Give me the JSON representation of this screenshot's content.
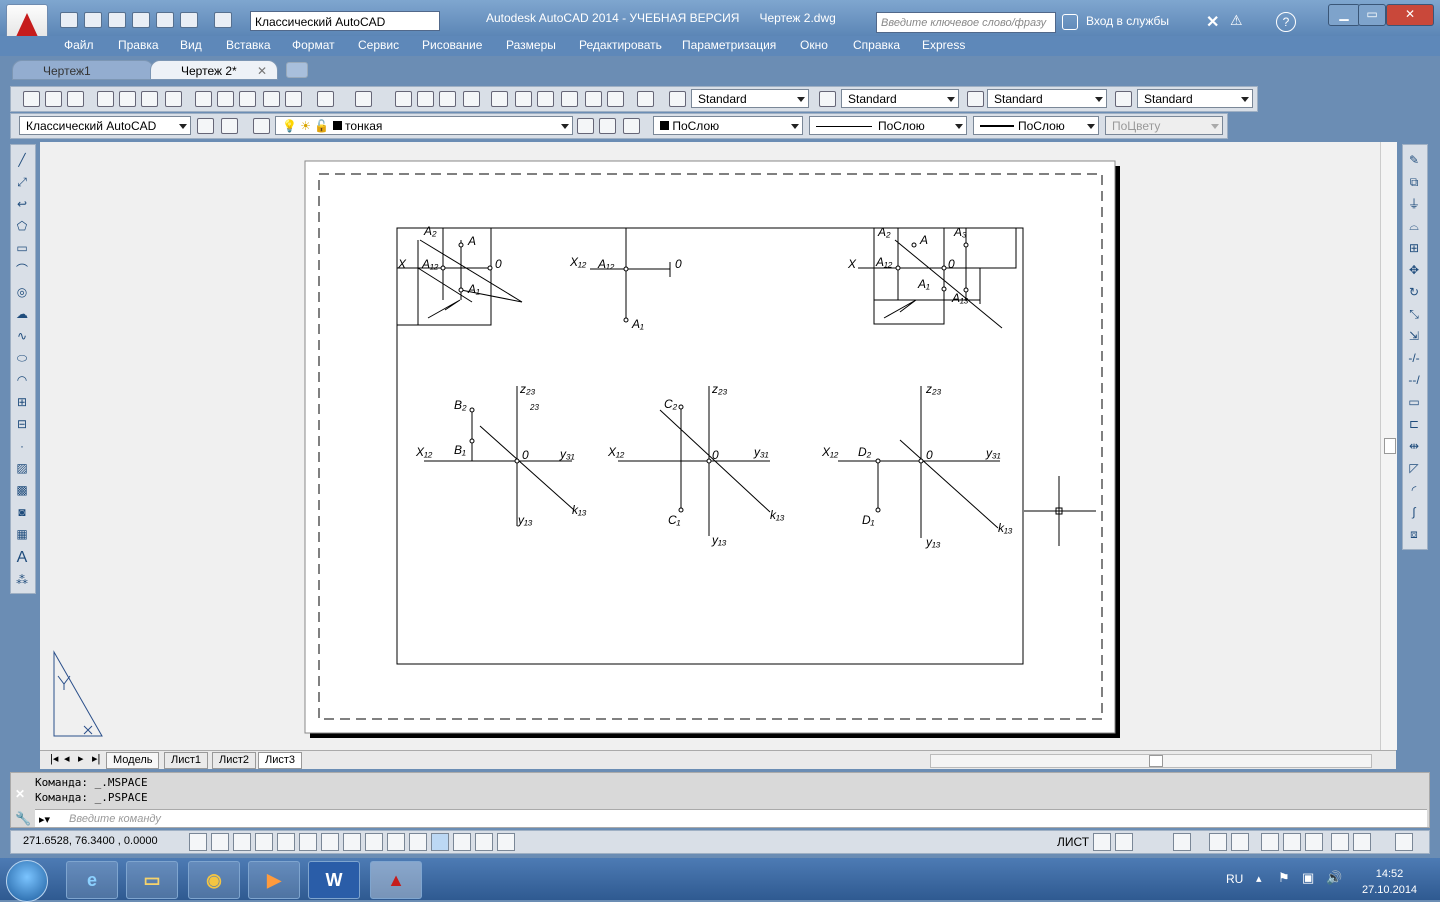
{
  "window": {
    "title": "Autodesk AutoCAD 2014 - УЧЕБНАЯ ВЕРСИЯ",
    "filename": "Чертеж 2.dwg",
    "workspace": "Классический AutoCAD",
    "search_placeholder": "Введите ключевое слово/фразу",
    "login": "Вход в службы",
    "help_label": "?"
  },
  "menu": [
    "Файл",
    "Правка",
    "Вид",
    "Вставка",
    "Формат",
    "Сервис",
    "Рисование",
    "Размеры",
    "Редактировать",
    "Параметризация",
    "Окно",
    "Справка",
    "Express"
  ],
  "doc_tabs": [
    {
      "label": "Чертеж1",
      "active": false
    },
    {
      "label": "Чертеж 2*",
      "active": true
    }
  ],
  "styles_toolbar": {
    "text_style": "Standard",
    "dim_style": "Standard",
    "table_style": "Standard",
    "mleader_style": "Standard"
  },
  "layers_toolbar": {
    "workspace": "Классический AutoCAD",
    "layer": "тонкая",
    "color": "ПоСлою",
    "linetype": "ПоСлою",
    "lineweight": "ПоСлою",
    "plotstyle": "ПоЦвету"
  },
  "drawing": {
    "top_left": {
      "x": "X",
      "a2": "A₂",
      "a": "A",
      "a12": "A₁₂",
      "o": "0",
      "a1": "A₁"
    },
    "top_center": {
      "x12": "X₁₂",
      "a12": "A₁₂",
      "o": "0",
      "a1": "A₁"
    },
    "top_right": {
      "a2": "A₂",
      "a": "A",
      "a3": "A₃",
      "x": "X",
      "a12": "A₁₂",
      "o": "0",
      "a1": "A₁",
      "a13": "A₁₃"
    },
    "b": {
      "z": "z₂₃",
      "b2": "B₂",
      "x": "X₁₂",
      "b1": "B₁",
      "o": "0",
      "y31": "y₃₁",
      "k": "k₁₃",
      "y13": "y₁₃",
      "sub": "23"
    },
    "c": {
      "z": "z₂₃",
      "c2": "C₂",
      "x": "X₁₂",
      "o": "0",
      "y31": "y₃₁",
      "k": "k₁₃",
      "c1": "C₁",
      "y13": "y₁₃"
    },
    "d": {
      "z": "z₂₃",
      "x": "X₁₂",
      "d2": "D₂",
      "o": "0",
      "y31": "y₃₁",
      "d1": "D₁",
      "k": "k₁₃",
      "y13": "y₁₃"
    }
  },
  "layout_tabs": [
    "Модель",
    "Лист1",
    "Лист2",
    "Лист3"
  ],
  "command": {
    "history": [
      "Команда:  _.MSPACE",
      "Команда:  _.PSPACE"
    ],
    "placeholder": "Введите команду"
  },
  "status": {
    "coords": "271.6528, 76.3400 , 0.0000",
    "space": "ЛИСТ"
  },
  "taskbar": {
    "lang": "RU",
    "time": "14:52",
    "date": "27.10.2014",
    "word_label": "W"
  }
}
